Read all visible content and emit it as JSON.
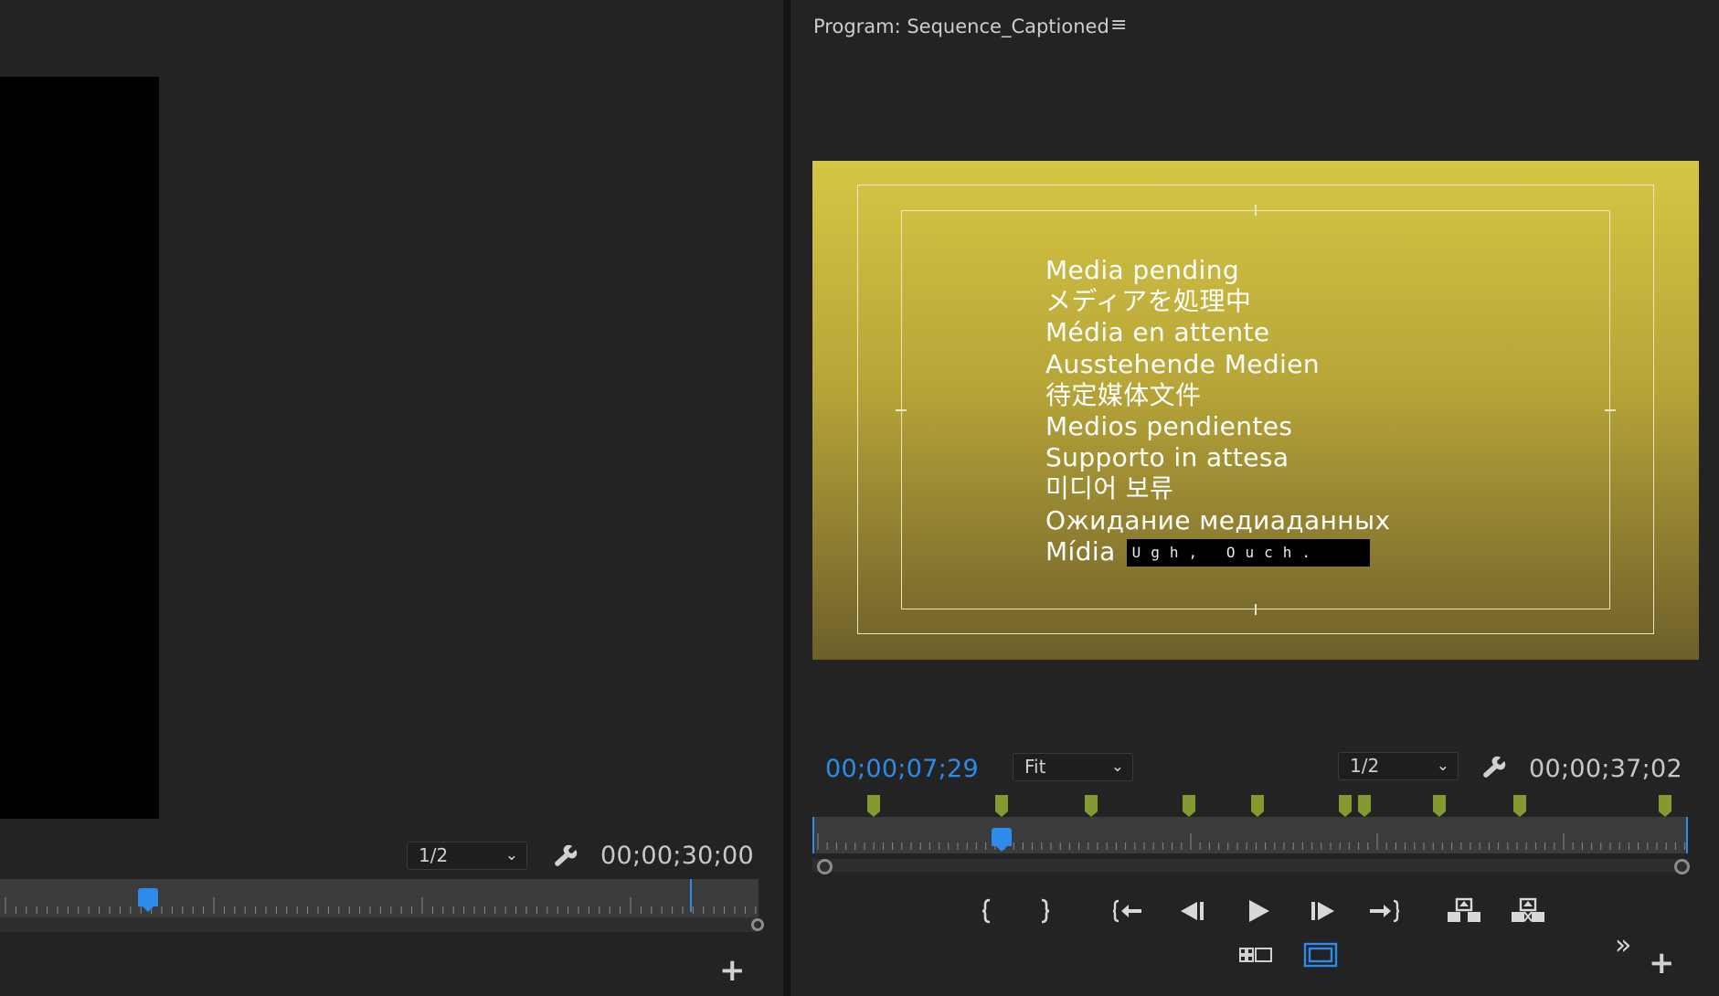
{
  "source_monitor": {
    "resolution": {
      "value": "1/2"
    },
    "duration": "00;00;30;00",
    "playhead_fraction": 0.215,
    "add_button": "+"
  },
  "program_monitor": {
    "title": "Program: Sequence_Captioned",
    "menu_icon": "≡",
    "current_time": "00;00;07;29",
    "duration": "00;00;37;02",
    "zoom": {
      "value": "Fit"
    },
    "resolution": {
      "value": "1/2"
    },
    "caption_lines": [
      "Media pending",
      "メディアを処理中",
      "Média en attente",
      "Ausstehende Medien",
      "待定媒体文件",
      "Medios pendientes",
      "Supporto in attesa",
      "미디어 보류",
      "Ожидание медиаданных",
      "Mídia"
    ],
    "caption_box_text": "Ugh, Ouch.",
    "marker_fractions": [
      0.07,
      0.216,
      0.318,
      0.43,
      0.508,
      0.609,
      0.63,
      0.716,
      0.808,
      0.974
    ],
    "playhead_fraction": 0.216,
    "add_button": "+",
    "overflow_icon": "»"
  },
  "colors": {
    "timecode_current": "#2d8ceb",
    "marker": "#839a31",
    "video_gradient_top": "#d6c644",
    "video_gradient_bottom": "#6e5f2a"
  }
}
